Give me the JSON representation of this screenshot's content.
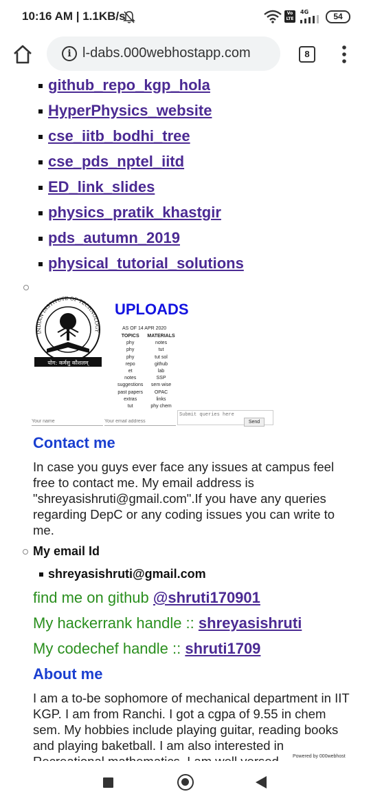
{
  "status_bar": {
    "time": "10:16 AM | 1.1KB/s",
    "network": "4G",
    "volte": "Vo LTE",
    "battery": "54"
  },
  "browser": {
    "url": "l-dabs.000webhostapp.com",
    "tab_count": "8"
  },
  "links": [
    "github_repo_kgp_hola",
    "HyperPhysics_website",
    "cse_iitb_bodhi_tree",
    "cse_pds_nptel_iitd",
    "ED_link_slides",
    "physics_pratik_khastgir",
    "pds_autumn_2019",
    "physical_tutorial_solutions"
  ],
  "uploads": {
    "title": "UPLOADS",
    "as_of": "AS OF 14 APR 2020",
    "headers": [
      "TOPICS",
      "MATERIALS"
    ],
    "rows": [
      [
        "phy",
        "notes"
      ],
      [
        "phy",
        "tut"
      ],
      [
        "phy",
        "tut sol"
      ],
      [
        "repo",
        "github"
      ],
      [
        "et",
        "lab"
      ],
      [
        "notes",
        "SSP"
      ],
      [
        "suggestions",
        "sem wise"
      ],
      [
        "past papers",
        "OPAC"
      ],
      [
        "extras",
        "links"
      ],
      [
        "tut",
        "phy chem"
      ]
    ]
  },
  "form": {
    "name_placeholder": "Your name",
    "email_placeholder": "Your email address",
    "query_placeholder": "Submit queries here",
    "send_label": "Send"
  },
  "logo": {
    "text_top": "INDIAN INSTITUTE OF TECHNOLOGY KHARAGPUR",
    "motto": "योग: कर्मसु कौशलम्"
  },
  "contact": {
    "heading": "Contact me",
    "body": "In case you guys ever face any issues at campus feel free to contact me. My email address is \"shreyasishruti@gmail.com\".If you have any queries regarding DepC or any coding issues you can write to me.",
    "email_label": "My email Id",
    "email": "shreyasishruti@gmail.com",
    "github_text": "find me on github ",
    "github_handle": "@shruti170901",
    "hackerrank_text": "My hackerrank handle :: ",
    "hackerrank_handle": "shreyasishruti",
    "codechef_text": "My codechef handle :: ",
    "codechef_handle": "shruti1709"
  },
  "about": {
    "heading": "About me",
    "body": "I am a to-be sophomore of mechanical department in IIT KGP. I am from Ranchi. I got a cgpa of 9.55 in chem sem. My hobbies include playing guitar, reading books and playing baketball. I am also interested in Recreational mathematics. I am well versed"
  },
  "footer_badge": "Powered by 000webhost"
}
